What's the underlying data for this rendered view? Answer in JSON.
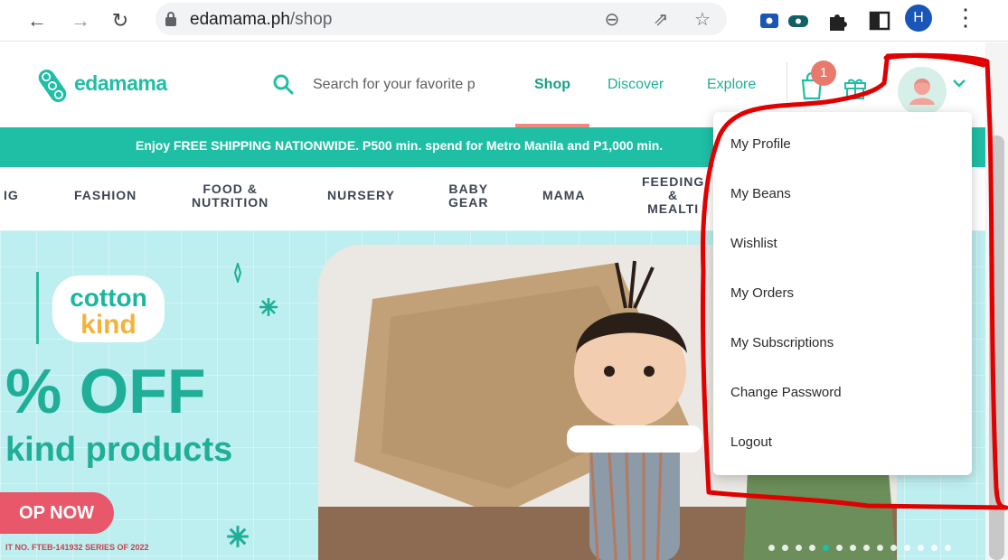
{
  "browser": {
    "url_domain": "edamama.ph",
    "url_path": "/shop",
    "profile_initial": "H",
    "icons": [
      "back-arrow-icon",
      "forward-arrow-icon",
      "reload-icon",
      "lock-icon",
      "zoom-out-icon",
      "share-icon",
      "star-icon",
      "screen-cast-icon",
      "extension-icon",
      "puzzle-icon",
      "side-panel-icon",
      "kebab-menu-icon"
    ]
  },
  "header": {
    "logo_text": "edamama",
    "search_placeholder": "Search for your favorite p",
    "menu": [
      "Shop",
      "Discover",
      "Explore"
    ],
    "active_menu": "Shop",
    "cart_count": "1"
  },
  "promo": {
    "text": "Enjoy FREE SHIPPING NATIONWIDE. P500 min. spend for Metro Manila and P1,000 min."
  },
  "categories": [
    {
      "line1": "IG",
      "line2": ""
    },
    {
      "line1": "FASHION",
      "line2": ""
    },
    {
      "line1": "FOOD &",
      "line2": "NUTRITION"
    },
    {
      "line1": "NURSERY",
      "line2": ""
    },
    {
      "line1": "BABY",
      "line2": "GEAR"
    },
    {
      "line1": "MAMA",
      "line2": ""
    },
    {
      "line1": "FEEDING",
      "line2": "&",
      "line3": "MEALTI"
    }
  ],
  "hero": {
    "brand_line1": "cotton",
    "brand_line2": "kind",
    "discount": "% OFF",
    "products": "kind products",
    "cta": "OP NOW",
    "permit": "IT NO. FTEB-141932 SERIES OF 2022",
    "slides": 14,
    "active_slide": 4
  },
  "user_menu": {
    "items": [
      "My Profile",
      "My Beans",
      "Wishlist",
      "My Orders",
      "My Subscriptions",
      "Change Password",
      "Logout"
    ]
  },
  "colors": {
    "brand_teal": "#1fbfa6",
    "accent_coral": "#e8796c",
    "annotation_red": "#e00000"
  }
}
